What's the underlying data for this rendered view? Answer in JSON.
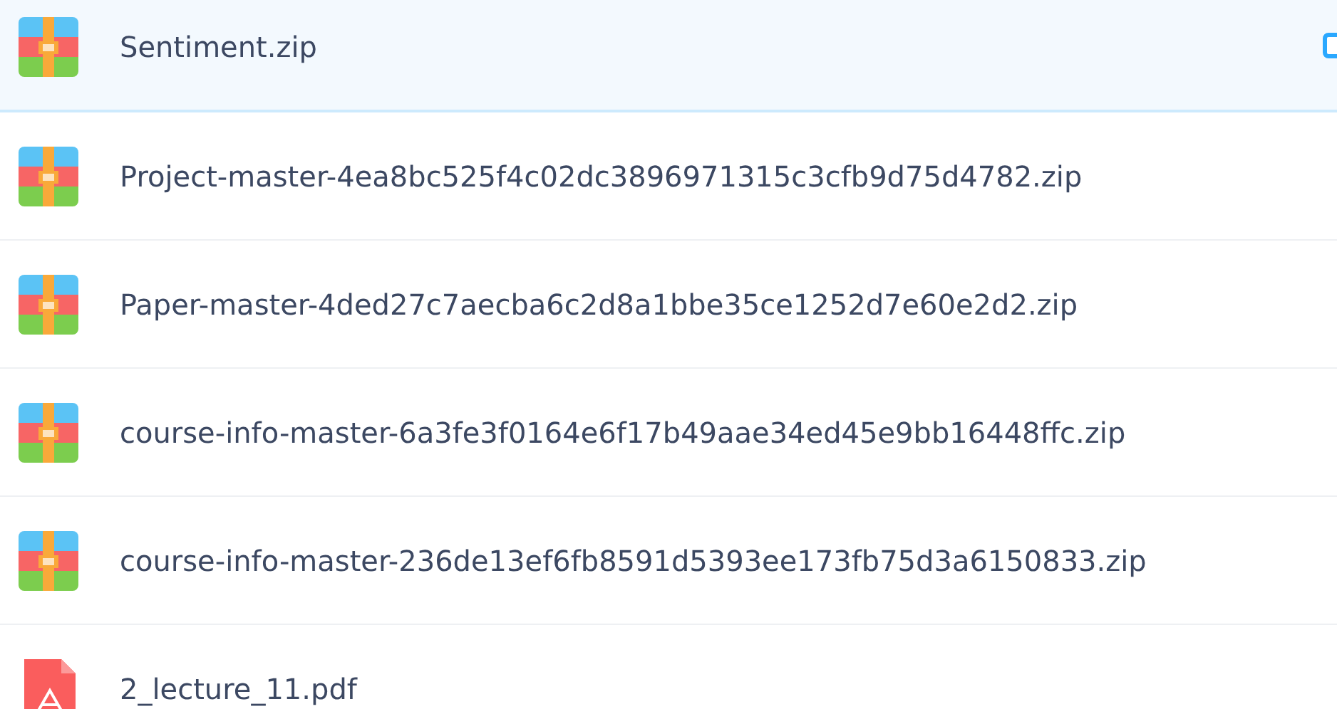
{
  "files": [
    {
      "name": "Sentiment.zip",
      "kind": "zip",
      "selected": true
    },
    {
      "name": "Project-master-4ea8bc525f4c02dc3896971315c3cfb9d75d4782.zip",
      "kind": "zip",
      "selected": false
    },
    {
      "name": "Paper-master-4ded27c7aecba6c2d8a1bbe35ce1252d7e60e2d2.zip",
      "kind": "zip",
      "selected": false
    },
    {
      "name": "course-info-master-6a3fe3f0164e6f17b49aae34ed45e9bb16448ffc.zip",
      "kind": "zip",
      "selected": false
    },
    {
      "name": "course-info-master-236de13ef6fb8591d5393ee173fb75d3a6150833.zip",
      "kind": "zip",
      "selected": false
    },
    {
      "name": "2_lecture_11.pdf",
      "kind": "pdf",
      "selected": false
    }
  ]
}
